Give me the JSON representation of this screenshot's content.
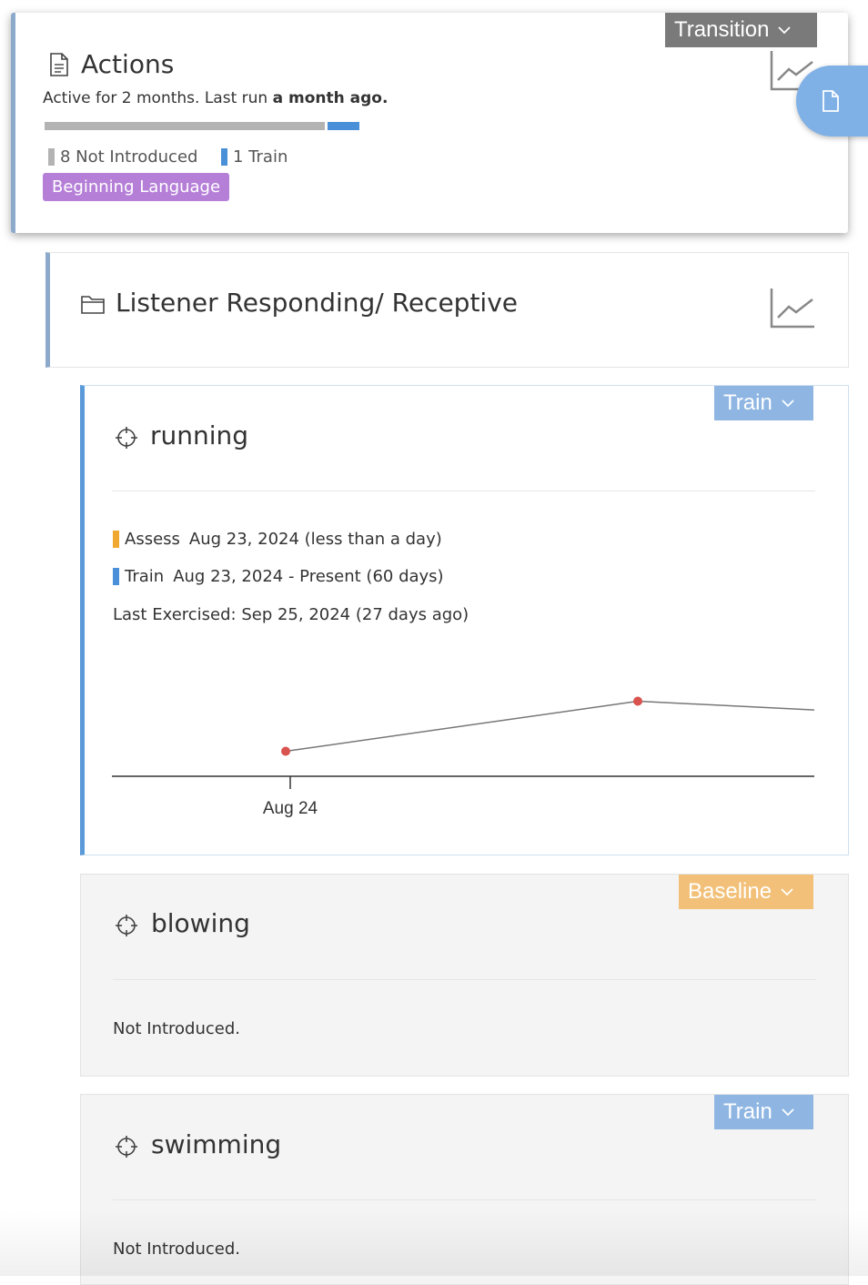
{
  "actions_card": {
    "status": "Transition",
    "title": "Actions",
    "subtitle_prefix": "Active for 2 months. Last run ",
    "subtitle_bold": "a month ago.",
    "progress": {
      "not_introduced": 8,
      "train": 1
    },
    "legend": [
      {
        "label": "8 Not Introduced",
        "color": "#b3b3b3"
      },
      {
        "label": "1 Train",
        "color": "#4a90d9"
      }
    ],
    "tag": "Beginning Language"
  },
  "folder": {
    "title": "Listener Responding/ Receptive"
  },
  "targets": [
    {
      "name": "running",
      "status": "Train",
      "phases": [
        {
          "label": "Assess",
          "range": "Aug 23, 2024 (less than a day)",
          "color": "#f0a830"
        },
        {
          "label": "Train",
          "range": "Aug 23, 2024 - Present (60 days)",
          "color": "#4a90d9"
        }
      ],
      "last_exercised": "Last Exercised: Sep 25, 2024 (27 days ago)"
    },
    {
      "name": "blowing",
      "status": "Baseline",
      "note": "Not Introduced."
    },
    {
      "name": "swimming",
      "status": "Train",
      "note": "Not Introduced."
    }
  ],
  "chart_data": {
    "type": "line",
    "x_tick_labels": [
      "Aug 24"
    ],
    "series": [
      {
        "points": [
          {
            "x": "Aug 24",
            "y": 1
          },
          {
            "x": "~Sep 12",
            "y": 3
          },
          {
            "x": "~Sep 20",
            "y": 2.65
          }
        ]
      }
    ],
    "point_color": "#d9534f",
    "line_color": "#777777"
  }
}
